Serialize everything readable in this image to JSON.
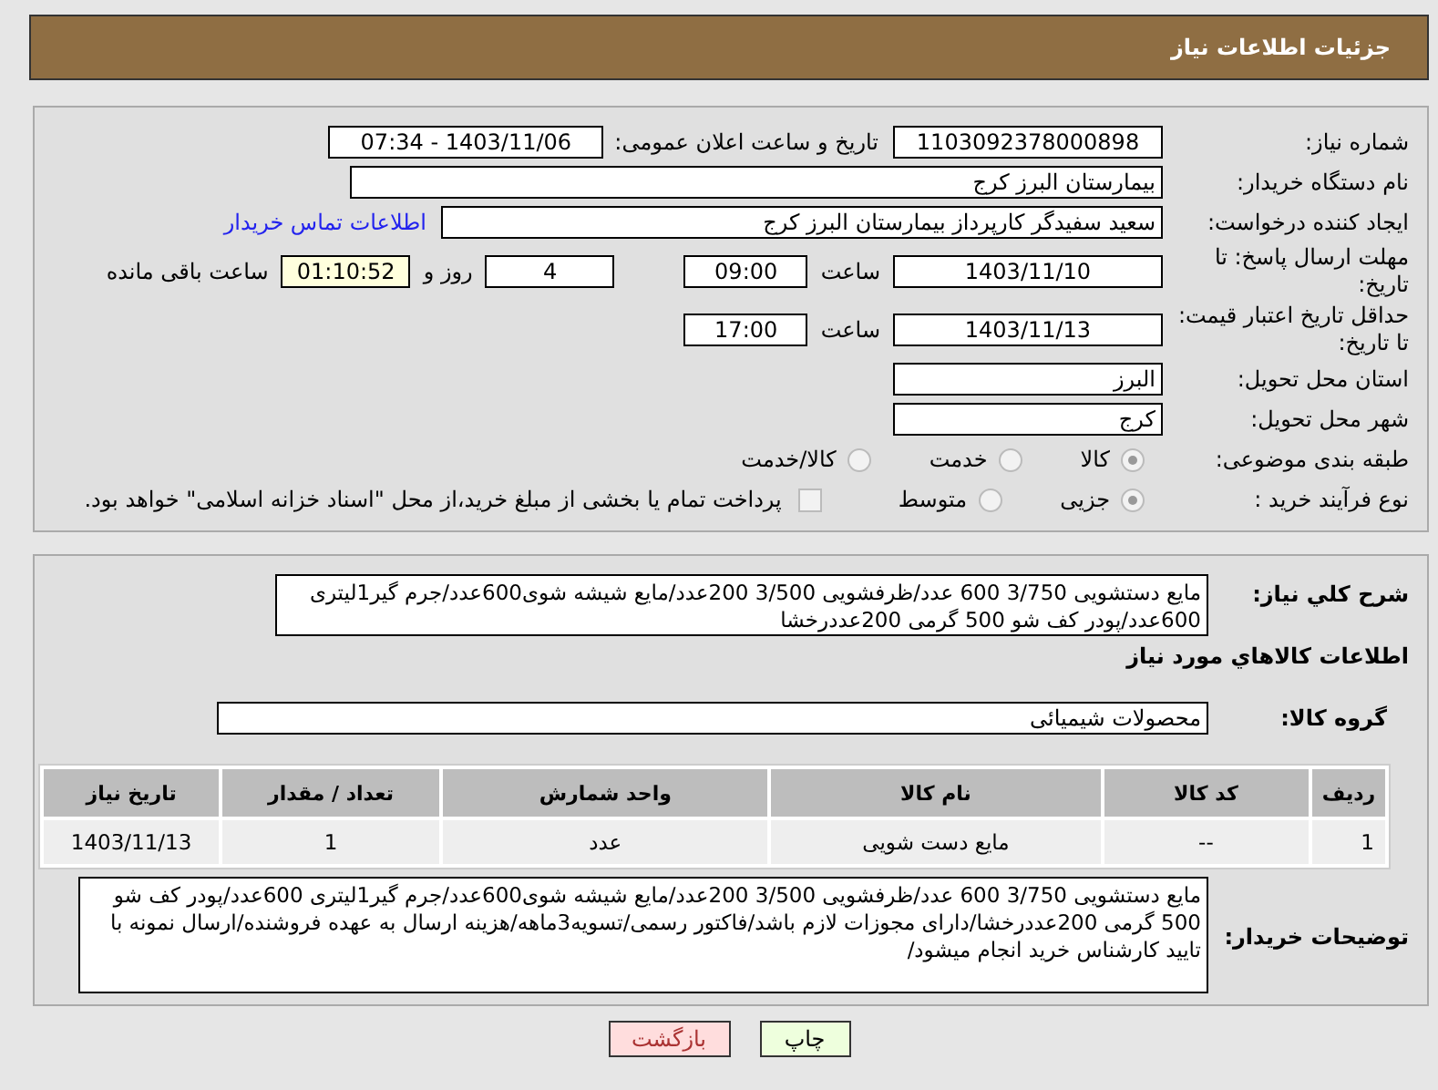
{
  "header": {
    "title": "جزئیات اطلاعات نیاز"
  },
  "need_number": {
    "label": "شماره نیاز:",
    "value": "1103092378000898"
  },
  "announce": {
    "label": "تاریخ و ساعت اعلان عمومی:",
    "value": "1403/11/06 - 07:34"
  },
  "buyer_org": {
    "label": "نام دستگاه خریدار:",
    "value": "بیمارستان البرز کرج"
  },
  "requester": {
    "label": "ایجاد کننده درخواست:",
    "value": "سعید سفیدگر کارپرداز بیمارستان البرز کرج",
    "link": "اطلاعات تماس خریدار"
  },
  "reply_deadline": {
    "label": "مهلت ارسال پاسخ: تا تاریخ:",
    "date": "1403/11/10",
    "time_label": "ساعت",
    "time": "09:00",
    "days": "4",
    "days_label": "روز و",
    "remaining": "01:10:52",
    "remaining_label": "ساعت باقی مانده"
  },
  "price_validity": {
    "label": "حداقل تاریخ اعتبار قیمت: تا تاریخ:",
    "date": "1403/11/13",
    "time_label": "ساعت",
    "time": "17:00"
  },
  "province": {
    "label": "استان محل تحویل:",
    "value": "البرز"
  },
  "city": {
    "label": "شهر محل تحویل:",
    "value": "کرج"
  },
  "category": {
    "label": "طبقه بندی موضوعی:",
    "options": [
      {
        "label": "کالا",
        "selected": true
      },
      {
        "label": "خدمت",
        "selected": false
      },
      {
        "label": "کالا/خدمت",
        "selected": false
      }
    ]
  },
  "purchase_process": {
    "label": "نوع فرآیند خرید :",
    "options": [
      {
        "label": "جزیی",
        "selected": true
      },
      {
        "label": "متوسط",
        "selected": false
      }
    ],
    "treasury": {
      "label": "پرداخت تمام یا بخشی از مبلغ خرید،از محل \"اسناد خزانه اسلامی\" خواهد بود.",
      "checked": false
    }
  },
  "summary": {
    "label": "شرح کلي نياز:",
    "value": "مایع دستشویی 3/750 600 عدد/ظرفشویی 3/500 200عدد/مایع شیشه شوی600عدد/جرم گیر1لیتری 600عدد/پودر کف شو 500 گرمی 200عددرخشا"
  },
  "items_title": "اطلاعات کالاهاي مورد نياز",
  "goods_group": {
    "label": "گروه کالا:",
    "value": "محصولات شیمیائی"
  },
  "table": {
    "columns": [
      "ردیف",
      "کد کالا",
      "نام کالا",
      "واحد شمارش",
      "تعداد / مقدار",
      "تاریخ نیاز"
    ],
    "rows": [
      [
        "1",
        "--",
        "مایع دست شویی",
        "عدد",
        "1",
        "1403/11/13"
      ]
    ]
  },
  "buyer_notes": {
    "label": "توضیحات خریدار:",
    "value": "مایع دستشویی 3/750 600 عدد/ظرفشویی 3/500 200عدد/مایع شیشه شوی600عدد/جرم گیر1لیتری 600عدد/پودر کف شو 500 گرمی 200عددرخشا/دارای مجوزات لازم باشد/فاکتور رسمی/تسویه3ماهه/هزینه ارسال به عهده فروشنده/ارسال نمونه با تایید کارشناس خرید انجام میشود/"
  },
  "buttons": [
    {
      "label": "چاپ",
      "kind": "print"
    },
    {
      "label": "بازگشت",
      "kind": "back"
    }
  ]
}
